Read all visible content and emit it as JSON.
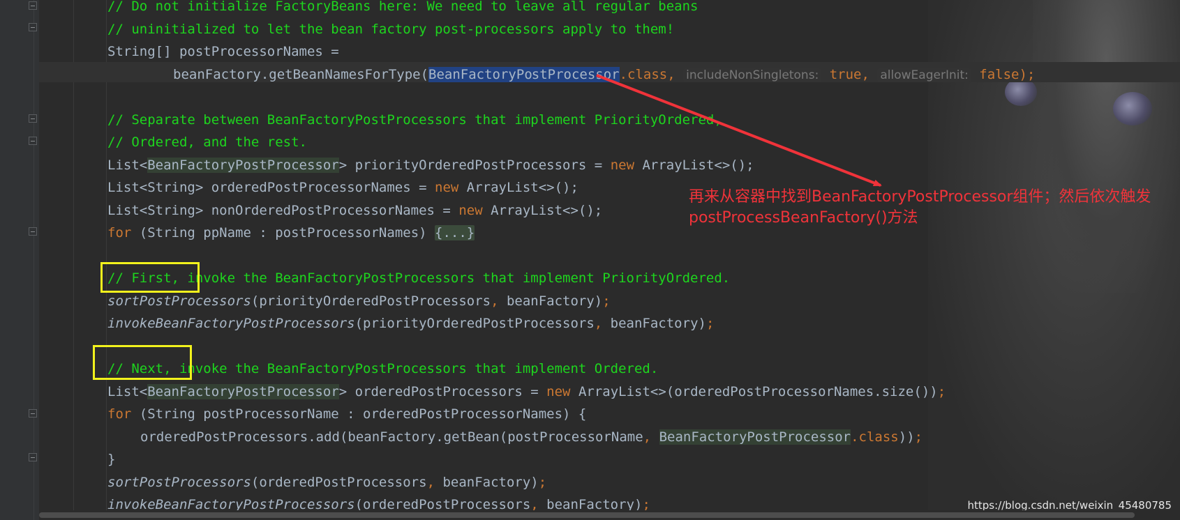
{
  "code_lines": [
    {
      "indent": 0,
      "tokens": [
        {
          "t": "// Do not initialize FactoryBeans here: We need to leave all regular beans",
          "c": "c"
        }
      ]
    },
    {
      "indent": 0,
      "tokens": [
        {
          "t": "// uninitialized to let the bean factory post-processors apply to them!",
          "c": "c"
        }
      ]
    },
    {
      "indent": 0,
      "tokens": [
        {
          "t": "String[] postProcessorNames ="
        }
      ]
    },
    {
      "indent": 1,
      "tokens": [
        {
          "t": "beanFactory.getBeanNamesForType("
        },
        {
          "t": "BeanFactoryPo",
          "c": "sel"
        },
        {
          "caret": true
        },
        {
          "t": "stProcessor",
          "c": "sel"
        },
        {
          "t": ".class, ",
          "c": "k"
        },
        {
          "t": "includeNonSingletons:",
          "c": "hint"
        },
        {
          "t": " true, ",
          "c": "k"
        },
        {
          "t": "allowEagerInit:",
          "c": "hint"
        },
        {
          "t": " false);",
          "c": "k"
        }
      ]
    },
    {
      "indent": 0,
      "tokens": []
    },
    {
      "indent": 0,
      "tokens": [
        {
          "t": "// Separate between BeanFactoryPostProcessors that implement PriorityOrdered,",
          "c": "c"
        }
      ]
    },
    {
      "indent": 0,
      "tokens": [
        {
          "t": "// Ordered, and the rest.",
          "c": "c"
        }
      ]
    },
    {
      "indent": 0,
      "tokens": [
        {
          "t": "List<"
        },
        {
          "t": "BeanFactoryPostProcessor",
          "c": "hl"
        },
        {
          "t": "> priorityOrderedPostProcessors = "
        },
        {
          "t": "new",
          "c": "k"
        },
        {
          "t": " ArrayList<>();"
        }
      ]
    },
    {
      "indent": 0,
      "tokens": [
        {
          "t": "List<String> orderedPostProcessorNames = "
        },
        {
          "t": "new",
          "c": "k"
        },
        {
          "t": " ArrayList<>();"
        }
      ]
    },
    {
      "indent": 0,
      "tokens": [
        {
          "t": "List<String> nonOrderedPostProcessorNames = "
        },
        {
          "t": "new",
          "c": "k"
        },
        {
          "t": " ArrayList<>();"
        }
      ]
    },
    {
      "indent": 0,
      "tokens": [
        {
          "t": "for",
          "c": "k"
        },
        {
          "t": " (String ppName : postProcessorNames) "
        },
        {
          "t": "{...}",
          "c": "fold-region"
        }
      ]
    },
    {
      "indent": 0,
      "tokens": []
    },
    {
      "indent": 0,
      "tokens": [
        {
          "t": "// First, invoke the BeanFactoryPostProcessors that implement PriorityOrdered.",
          "c": "c"
        }
      ]
    },
    {
      "indent": 0,
      "tokens": [
        {
          "t": "sortPostProcessors",
          "c": "i"
        },
        {
          "t": "(priorityOrderedPostProcessors"
        },
        {
          "t": ",",
          "c": "k"
        },
        {
          "t": " beanFactory)"
        },
        {
          "t": ";",
          "c": "k"
        }
      ]
    },
    {
      "indent": 0,
      "tokens": [
        {
          "t": "invokeBeanFactoryPostProcessors",
          "c": "i"
        },
        {
          "t": "(priorityOrderedPostProcessors"
        },
        {
          "t": ",",
          "c": "k"
        },
        {
          "t": " beanFactory)"
        },
        {
          "t": ";",
          "c": "k"
        }
      ]
    },
    {
      "indent": 0,
      "tokens": []
    },
    {
      "indent": 0,
      "tokens": [
        {
          "t": "// Next, invoke the BeanFactoryPostProcessors that implement Ordered.",
          "c": "c"
        }
      ]
    },
    {
      "indent": 0,
      "tokens": [
        {
          "t": "List<"
        },
        {
          "t": "BeanFactoryPostProcessor",
          "c": "hl"
        },
        {
          "t": "> orderedPostProcessors = "
        },
        {
          "t": "new",
          "c": "k"
        },
        {
          "t": " ArrayList<>(orderedPostProcessorNames.size())"
        },
        {
          "t": ";",
          "c": "k"
        }
      ]
    },
    {
      "indent": 0,
      "tokens": [
        {
          "t": "for",
          "c": "k"
        },
        {
          "t": " (String postProcessorName : orderedPostProcessorNames) {"
        }
      ]
    },
    {
      "indent": 2,
      "tokens": [
        {
          "t": "orderedPostProcessors.add(beanFactory.getBean(postProcessorName"
        },
        {
          "t": ",",
          "c": "k"
        },
        {
          "t": " "
        },
        {
          "t": "BeanFactoryPostProcessor",
          "c": "hl"
        },
        {
          "t": ".class",
          "c": "k"
        },
        {
          "t": "))"
        },
        {
          "t": ";",
          "c": "k"
        }
      ]
    },
    {
      "indent": 0,
      "tokens": [
        {
          "t": "}"
        }
      ]
    },
    {
      "indent": 0,
      "tokens": [
        {
          "t": "sortPostProcessors",
          "c": "i"
        },
        {
          "t": "(orderedPostProcessors"
        },
        {
          "t": ",",
          "c": "k"
        },
        {
          "t": " beanFactory)"
        },
        {
          "t": ";",
          "c": "k"
        }
      ]
    },
    {
      "indent": 0,
      "tokens": [
        {
          "t": "invokeBeanFactoryPostProcessors",
          "c": "i"
        },
        {
          "t": "(orderedPostProcessors"
        },
        {
          "t": ",",
          "c": "k"
        },
        {
          "t": " beanFactory)"
        },
        {
          "t": ";",
          "c": "k"
        }
      ]
    }
  ],
  "annotation": {
    "line1": "再来从容器中找到BeanFactoryPostProcessor组件；然后依次触发",
    "line2": "postProcessBeanFactory()方法",
    "color": "#f0333a",
    "box_color": "#f2f21c"
  },
  "watermark": "https://blog.csdn.net/weixin_45480785",
  "theme": {
    "background": "#2b2b2b",
    "comment": "#1ed51e",
    "keyword": "#cc7832",
    "text": "#a9b7c6",
    "selection": "#214283"
  }
}
